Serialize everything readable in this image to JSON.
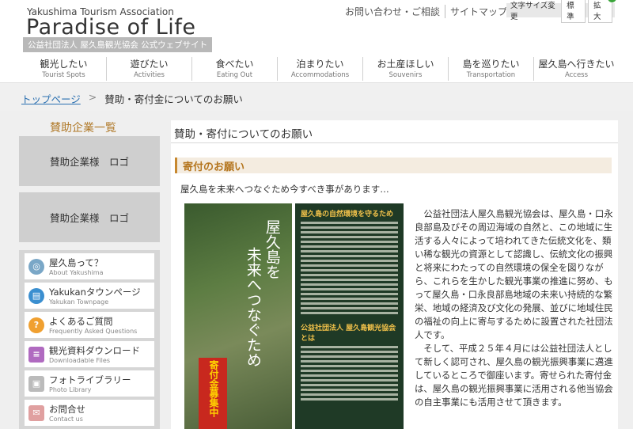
{
  "header": {
    "logo_en": "Yakushima Tourism Association",
    "logo_main": "Paradise of Life",
    "logo_sub": "公益社団法人 屋久島観光協会 公式ウェブサイト",
    "toplinks": [
      "お問い合わせ・ご相談",
      "サイトマップ"
    ],
    "fontsize": {
      "label": "文字サイズ変更",
      "normal": "標準",
      "large": "拡大",
      "plus": "+"
    }
  },
  "nav": [
    {
      "jp": "観光したい",
      "en": "Tourist Spots"
    },
    {
      "jp": "遊びたい",
      "en": "Activities"
    },
    {
      "jp": "食べたい",
      "en": "Eating Out"
    },
    {
      "jp": "泊まりたい",
      "en": "Accommodations"
    },
    {
      "jp": "お土産ほしい",
      "en": "Souvenirs"
    },
    {
      "jp": "島を巡りたい",
      "en": "Transportation"
    },
    {
      "jp": "屋久島へ行きたい",
      "en": "Access"
    }
  ],
  "breadcrumb": {
    "home": "トップページ",
    "sep": ">",
    "current": "賛助・寄付金についてのお願い"
  },
  "sidebar": {
    "title": "賛助企業一覧",
    "ads": [
      "賛助企業様　ロゴ",
      "賛助企業様　ロゴ"
    ],
    "menu": [
      {
        "jp": "屋久島って？",
        "en": "About Yakushima",
        "icon": "globe-icon",
        "color": "#7aa7c7"
      },
      {
        "jp": "Yakukanタウンページ",
        "en": "Yakukan Townpage",
        "icon": "book-icon",
        "color": "#3b8fd0"
      },
      {
        "jp": "よくあるご質問",
        "en": "Frequently Asked Questions",
        "icon": "question-icon",
        "color": "#f0a030"
      },
      {
        "jp": "観光資料ダウンロード",
        "en": "Downloadable Files",
        "icon": "document-icon",
        "color": "#b06ac0"
      },
      {
        "jp": "フォトライブラリー",
        "en": "Photo Library",
        "icon": "camera-icon",
        "color": "#bbbbbb"
      },
      {
        "jp": "お問合せ",
        "en": "Contact us",
        "icon": "mail-icon",
        "color": "#e0a0a0"
      }
    ]
  },
  "content": {
    "page_title": "賛助・寄付についてのお願い",
    "section_title": "寄付のお願い",
    "lead": "屋久島を未来へつなぐため今すべき事があります…",
    "poster": {
      "vertical1": "屋久島を",
      "vertical2": "未来へつなぐため",
      "org": "公益社団法人 屋久島観光協会",
      "red": "寄付金募集中",
      "right_h1": "屋久島の自然環境を守るため",
      "right_h2": "公益社団法人 屋久島観光協会とは"
    },
    "paragraphs": [
      "公益社団法人屋久島観光協会は、屋久島・口永良部島及びその周辺海域の自然と、この地域に生活する人々によって培われてきた伝統文化を、類い稀な観光の資源として認識し、伝統文化の振興と将来にわたっての自然環境の保全を図りながら、これらを生かした観光事業の推進に努め、もって屋久島・口永良部島地域の未来い持続的な繁栄、地域の経済及び文化の発展、並びに地域住民の福祉の向上に寄与するために設置された社団法人です。",
      "そして、平成２５年４月には公益社団法人として新しく認可され、屋久島の観光振興事業に邁進しているところで御座います。寄せられた寄付金は、屋久島の観光振興事業に活用される他当協会の自主事業にも活用させて頂きます。"
    ]
  }
}
